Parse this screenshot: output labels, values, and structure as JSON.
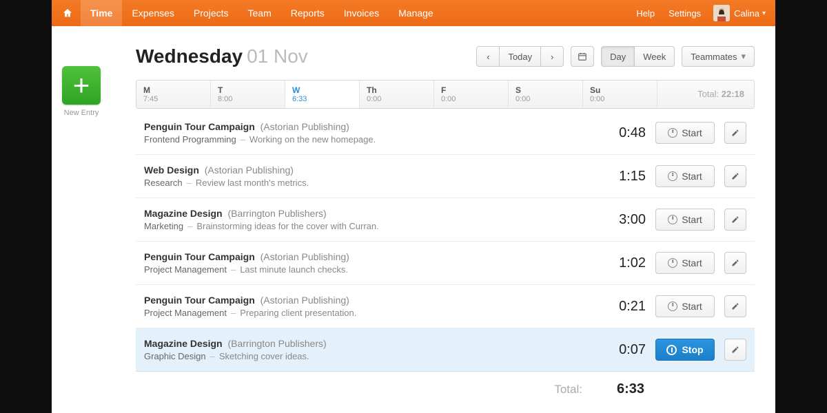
{
  "nav": {
    "items": [
      "Time",
      "Expenses",
      "Projects",
      "Team",
      "Reports",
      "Invoices",
      "Manage"
    ],
    "active": 0,
    "help": "Help",
    "settings": "Settings",
    "user": "Calina"
  },
  "date": {
    "weekday": "Wednesday",
    "rest": "01 Nov"
  },
  "controls": {
    "today": "Today",
    "day": "Day",
    "week": "Week",
    "teammates": "Teammates"
  },
  "new_entry": {
    "label": "New Entry"
  },
  "week": {
    "days": [
      {
        "abbr": "M",
        "time": "7:45"
      },
      {
        "abbr": "T",
        "time": "8:00"
      },
      {
        "abbr": "W",
        "time": "6:33"
      },
      {
        "abbr": "Th",
        "time": "0:00"
      },
      {
        "abbr": "F",
        "time": "0:00"
      },
      {
        "abbr": "S",
        "time": "0:00"
      },
      {
        "abbr": "Su",
        "time": "0:00"
      }
    ],
    "active": 2,
    "total_label": "Total:",
    "total_value": "22:18"
  },
  "labels": {
    "start": "Start",
    "stop": "Stop"
  },
  "entries": [
    {
      "project": "Penguin Tour Campaign",
      "client": "(Astorian Publishing)",
      "task": "Frontend Programming",
      "notes": "Working on the new homepage.",
      "dur": "0:48",
      "running": false
    },
    {
      "project": "Web Design",
      "client": "(Astorian Publishing)",
      "task": "Research",
      "notes": "Review last month's metrics.",
      "dur": "1:15",
      "running": false
    },
    {
      "project": "Magazine Design",
      "client": "(Barrington Publishers)",
      "task": "Marketing",
      "notes": "Brainstorming ideas for the cover with Curran.",
      "dur": "3:00",
      "running": false
    },
    {
      "project": "Penguin Tour Campaign",
      "client": "(Astorian Publishing)",
      "task": "Project Management",
      "notes": "Last minute launch checks.",
      "dur": "1:02",
      "running": false
    },
    {
      "project": "Penguin Tour Campaign",
      "client": "(Astorian Publishing)",
      "task": "Project Management",
      "notes": "Preparing client presentation.",
      "dur": "0:21",
      "running": false
    },
    {
      "project": "Magazine Design",
      "client": "(Barrington Publishers)",
      "task": "Graphic Design",
      "notes": "Sketching cover ideas.",
      "dur": "0:07",
      "running": true
    }
  ],
  "footer": {
    "label": "Total:",
    "value": "6:33"
  }
}
